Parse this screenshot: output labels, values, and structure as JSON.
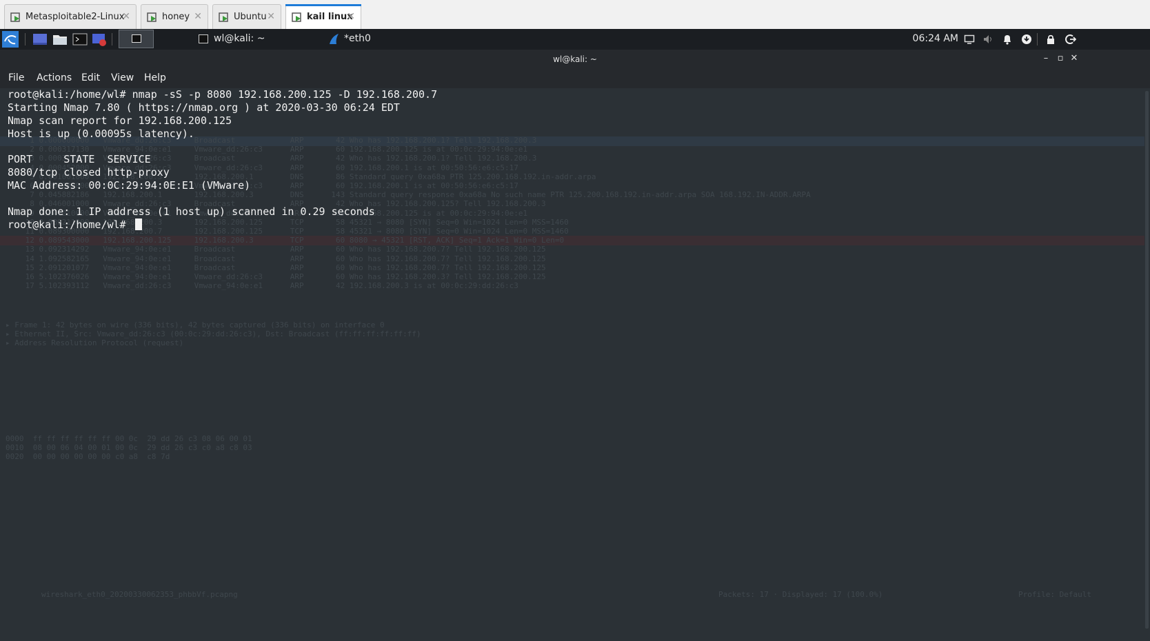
{
  "vm_tabs": [
    {
      "label": "Metasploitable2-Linux"
    },
    {
      "label": "honey"
    },
    {
      "label": "Ubuntu"
    },
    {
      "label": "kail linux"
    }
  ],
  "taskbar": {
    "tasks": [
      {
        "label": "wl@kali: ~"
      },
      {
        "label": "*eth0"
      }
    ],
    "clock": "06:24 AM"
  },
  "window": {
    "title": "wl@kali: ~",
    "menu": [
      "File",
      "Actions",
      "Edit",
      "View",
      "Help"
    ]
  },
  "terminal": {
    "lines": [
      "root@kali:/home/wl# nmap -sS -p 8080 192.168.200.125 -D 192.168.200.7",
      "Starting Nmap 7.80 ( https://nmap.org ) at 2020-03-30 06:24 EDT",
      "Nmap scan report for 192.168.200.125",
      "Host is up (0.00095s latency).",
      "",
      "PORT     STATE  SERVICE",
      "8080/tcp closed http-proxy",
      "MAC Address: 00:0C:29:94:0E:E1 (VMware)",
      "",
      "Nmap done: 1 IP address (1 host up) scanned in 0.29 seconds"
    ],
    "prompt": "root@kali:/home/wl# "
  },
  "background_wireshark": {
    "packet_rows": [
      "  1 0.000000000   Vmware_dd:26:c3     Broadcast            ARP       42 Who has 192.168.200.1? Tell 192.168.200.3",
      "  2 0.000317130   Vmware_94:0e:e1     Vmware_dd:26:c3      ARP       60 192.168.200.125 is at 00:0c:29:94:0e:e1",
      "  3 0.000318000   Vmware_dd:26:c3     Broadcast            ARP       42 Who has 192.168.200.1? Tell 192.168.200.3",
      "  4 0.000452000   Vmware_dd:26:c3     Vmware_dd:26:c3      ARP       60 192.168.200.1 is at 00:50:56:e6:c5:17",
      "  5 0.001001000   192.168.200.3       192.168.200.1        DNS       86 Standard query 0xa68a PTR 125.200.168.192.in-addr.arpa",
      "  6 0.001202000   Vmware_e6:c5:17     Vmware_dd:26:c3      ARP       60 192.168.200.1 is at 00:50:56:e6:c5:17",
      "  7 0.045882186   192.168.200.1       192.168.200.3        DNS      143 Standard query response 0xa68a No such name PTR 125.200.168.192.in-addr.arpa SOA 168.192.IN-ADDR.ARPA",
      "  8 0.046001000   Vmware_dd:26:c3     Broadcast            ARP       42 Who has 192.168.200.125? Tell 192.168.200.3",
      "  9 0.046210000   Vmware_94:0e:e1     Vmware_dd:26:c3      ARP       60 192.168.200.125 is at 00:0c:29:94:0e:e1",
      " 10 0.089211000   192.168.200.3       192.168.200.125      TCP       58 45321 → 8080 [SYN] Seq=0 Win=1024 Len=0 MSS=1460",
      " 11 0.089300000   192.168.200.7       192.168.200.125      TCP       58 45321 → 8080 [SYN] Seq=0 Win=1024 Len=0 MSS=1460",
      " 12 0.089543000   192.168.200.125     192.168.200.3        TCP       60 8080 → 45321 [RST, ACK] Seq=1 Ack=1 Win=0 Len=0",
      " 13 0.092314292   Vmware_94:0e:e1     Broadcast            ARP       60 Who has 192.168.200.7? Tell 192.168.200.125",
      " 14 1.092582165   Vmware_94:0e:e1     Broadcast            ARP       60 Who has 192.168.200.7? Tell 192.168.200.125",
      " 15 2.091201077   Vmware_94:0e:e1     Broadcast            ARP       60 Who has 192.168.200.7? Tell 192.168.200.125",
      " 16 5.102376026   Vmware_94:0e:e1     Vmware_dd:26:c3      ARP       60 Who has 192.168.200.3? Tell 192.168.200.125",
      " 17 5.102393112   Vmware_dd:26:c3     Vmware_94:0e:e1      ARP       42 192.168.200.3 is at 00:0c:29:dd:26:c3"
    ],
    "detail_rows": [
      "▸ Frame 1: 42 bytes on wire (336 bits), 42 bytes captured (336 bits) on interface 0",
      "▸ Ethernet II, Src: Vmware_dd:26:c3 (00:0c:29:dd:26:c3), Dst: Broadcast (ff:ff:ff:ff:ff:ff)",
      "▸ Address Resolution Protocol (request)"
    ],
    "hex_rows": [
      "0000  ff ff ff ff ff ff 00 0c  29 dd 26 c3 08 06 00 01",
      "0010  08 00 06 04 00 01 00 0c  29 dd 26 c3 c0 a8 c8 03",
      "0020  00 00 00 00 00 00 c0 a8  c8 7d"
    ],
    "status_file": "wireshark_eth0_20200330062353_phbbVf.pcapng",
    "status_packets": "Packets: 17 · Displayed: 17 (100.0%)",
    "status_profile": "Profile: Default"
  },
  "colors": {
    "terminal_bg": "#2b3136",
    "panel_bg": "#1b1e22",
    "accent": "#1d7bd8"
  }
}
